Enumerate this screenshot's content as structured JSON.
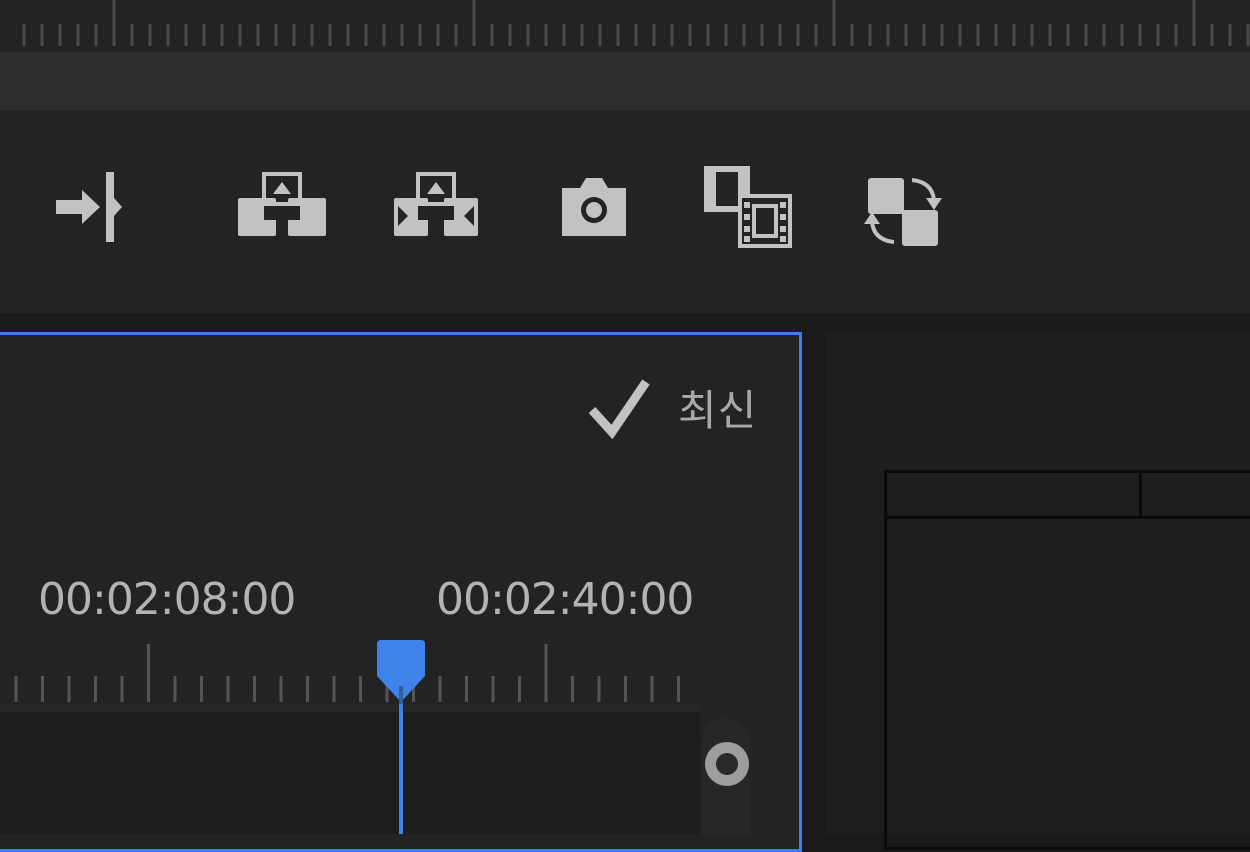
{
  "toolbar": {
    "buttons": [
      {
        "name": "go-to-out-point"
      },
      {
        "name": "lift"
      },
      {
        "name": "extract"
      },
      {
        "name": "export-frame"
      },
      {
        "name": "comparison-view"
      },
      {
        "name": "toggle-proxies"
      }
    ]
  },
  "timeline": {
    "status_label": "최신",
    "timecodes": [
      "00:02:08:00",
      "00:02:40:00"
    ]
  },
  "colors": {
    "accent": "#3d7fe6",
    "icon": "#c2c2c2",
    "background": "#1a1a1a",
    "panel": "#232323"
  }
}
